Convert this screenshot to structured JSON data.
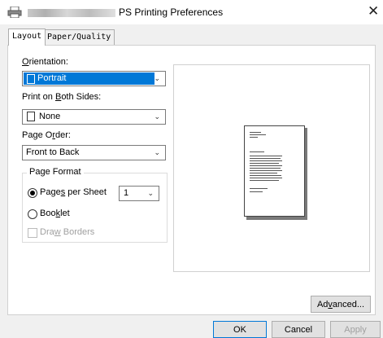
{
  "window": {
    "title": "PS Printing Preferences",
    "close_glyph": "✕"
  },
  "tabs": [
    {
      "label": "Layout"
    },
    {
      "label": "Paper/Quality"
    }
  ],
  "layout": {
    "orientation": {
      "label": "Orientation:",
      "value": "Portrait"
    },
    "print_both_sides": {
      "label": "Print on Both Sides:",
      "value": "None"
    },
    "page_order": {
      "label": "Page Order:",
      "value": "Front to Back"
    },
    "page_format": {
      "title": "Page Format",
      "pages_per_sheet": {
        "label": "Pages per Sheet",
        "value": "1",
        "selected": true
      },
      "booklet": {
        "label": "Booklet",
        "selected": false
      },
      "draw_borders": {
        "label": "Draw Borders",
        "checked": false,
        "enabled": false
      }
    }
  },
  "buttons": {
    "advanced": "Advanced...",
    "ok": "OK",
    "cancel": "Cancel",
    "apply": "Apply"
  },
  "icons": {
    "title": "printer-icon",
    "close": "close-icon",
    "chevron": "chevron-down-icon"
  },
  "colors": {
    "selection": "#0078d7",
    "dialog_bg": "#f0f0f0"
  }
}
